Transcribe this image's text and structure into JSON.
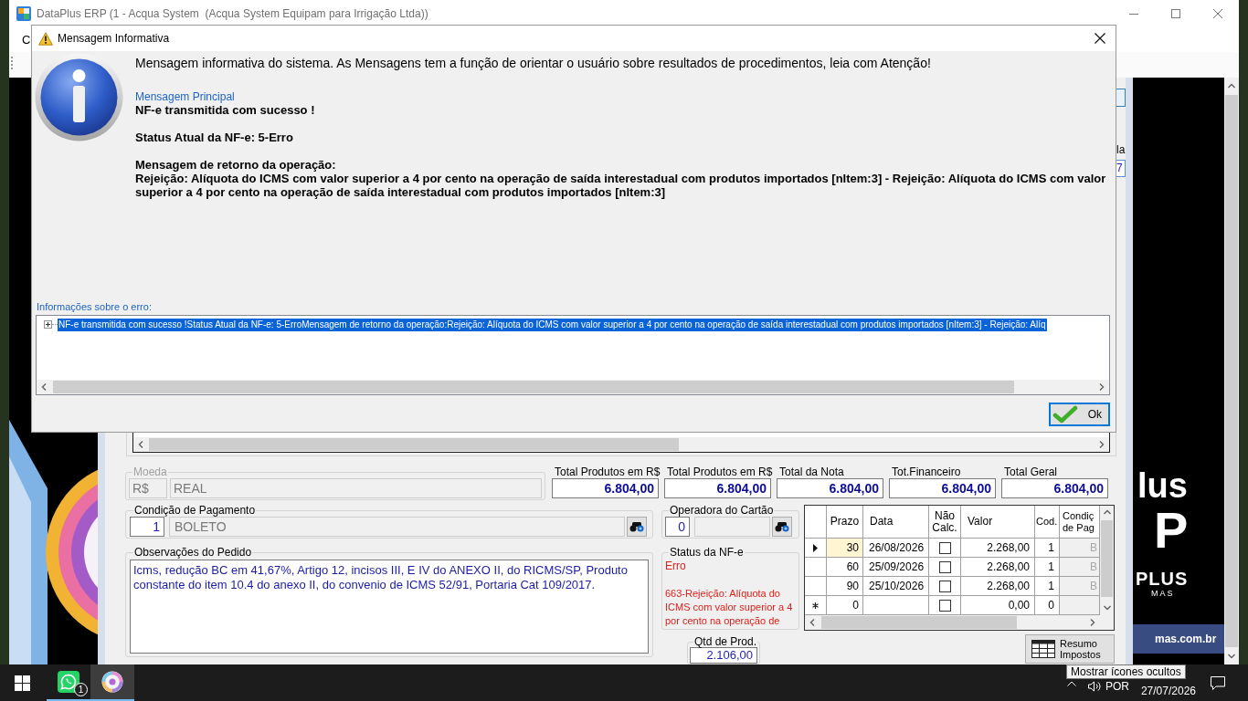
{
  "main_window": {
    "title": "DataPlus ERP (1 - Acqua System  (Acqua System Equipam para Irrigação Ltda))",
    "menu_fragment": "C"
  },
  "dialog": {
    "title": "Mensagem Informativa",
    "intro": "Mensagem informativa do sistema. As Mensagens tem a função de orientar o usuário sobre resultados de procedimentos, leia com Atenção!",
    "section_label": "Mensagem Principal",
    "message": {
      "headline": "NF-e transmitida com sucesso !",
      "status": "Status Atual da NF-e: 5-Erro",
      "return_heading": "Mensagem de retorno da operação:",
      "return_text": "Rejeição: Alíquota do ICMS com valor superior a 4 por cento na operação de saída interestadual com produtos importados [nItem:3] - Rejeição: Alíquota do ICMS com valor superior a 4 por cento na operação de saída interestadual com produtos importados [nItem:3]"
    },
    "error_info_label": "Informações sobre o erro:",
    "error_tree": [
      {
        "text": "NF-e transmitida com sucesso !Status Atual da NF-e: 5-ErroMensagem de retorno da operação:Rejeição: Alíquota do ICMS com valor superior a 4 por cento na operação de saída interestadual com produtos importados [nItem:3] - Rejeição: Alíq",
        "selected": true,
        "expanded": false
      }
    ],
    "ok_button": "Ok"
  },
  "side_panel": {
    "label": "la",
    "field_value": "7"
  },
  "form": {
    "currency": {
      "label": "Moeda",
      "disabled": true,
      "code": "R$",
      "name": "REAL"
    },
    "totals": [
      {
        "label": "Total Produtos em R$",
        "value": "6.804,00"
      },
      {
        "label": "Total Produtos em R$",
        "value": "6.804,00"
      },
      {
        "label": "Total da Nota",
        "value": "6.804,00"
      },
      {
        "label": "Tot.Financeiro",
        "value": "6.804,00"
      },
      {
        "label": "Total Geral",
        "value": "6.804,00"
      }
    ],
    "payment_condition": {
      "label": "Condição de Pagamento",
      "code": "1",
      "name": "BOLETO"
    },
    "card_operator": {
      "label": "Operadora do Cartão",
      "code": "0"
    },
    "notes": {
      "label": "Observações do Pedido",
      "value": "Icms, redução BC em 41,67%, Artigo 12, incisos III, E IV do ANEXO II, do RICMS/SP, Produto constante do item 10.4 do anexo II, do convenio de ICMS 52/91, Portaria Cat 109/2017."
    },
    "nfe_status": {
      "label": "Status da NF-e",
      "status": "Erro",
      "message": "663-Rejeição: Alíquota do ICMS com valor superior a 4 por cento na operação de"
    },
    "installments": {
      "columns": [
        "Prazo",
        "Data",
        "Não Calc.",
        "Valor",
        "Cod.",
        "Condiç de Pag"
      ],
      "rows": [
        {
          "kind": "data",
          "selected": true,
          "prazo": "30",
          "data": "26/08/2026",
          "nao_calc": false,
          "valor": "2.268,00",
          "cod": "1",
          "condicao": "B"
        },
        {
          "kind": "data",
          "selected": false,
          "prazo": "60",
          "data": "25/09/2026",
          "nao_calc": false,
          "valor": "2.268,00",
          "cod": "1",
          "condicao": "B"
        },
        {
          "kind": "data",
          "selected": false,
          "prazo": "90",
          "data": "25/10/2026",
          "nao_calc": false,
          "valor": "2.268,00",
          "cod": "1",
          "condicao": "B"
        },
        {
          "kind": "new",
          "selected": false,
          "prazo": "0",
          "nao_calc": false,
          "valor": "0,00",
          "cod": "0"
        }
      ]
    },
    "product_qty": {
      "label": "Qtd de Prod.",
      "value": "2.106,00"
    },
    "tax_summary_button": "Resumo Impostos"
  },
  "logo": {
    "word_end": "lus",
    "letter": "P",
    "brand": "PLUS",
    "tagline": "MAS",
    "website": "mas.com.br"
  },
  "taskbar": {
    "apps": [
      {
        "kind": "chat",
        "badge": "1",
        "selected": false
      },
      {
        "kind": "ring",
        "selected": true
      }
    ],
    "language": "POR",
    "date": "27/07/2026",
    "tooltip": "Mostrar ícones ocultos"
  }
}
